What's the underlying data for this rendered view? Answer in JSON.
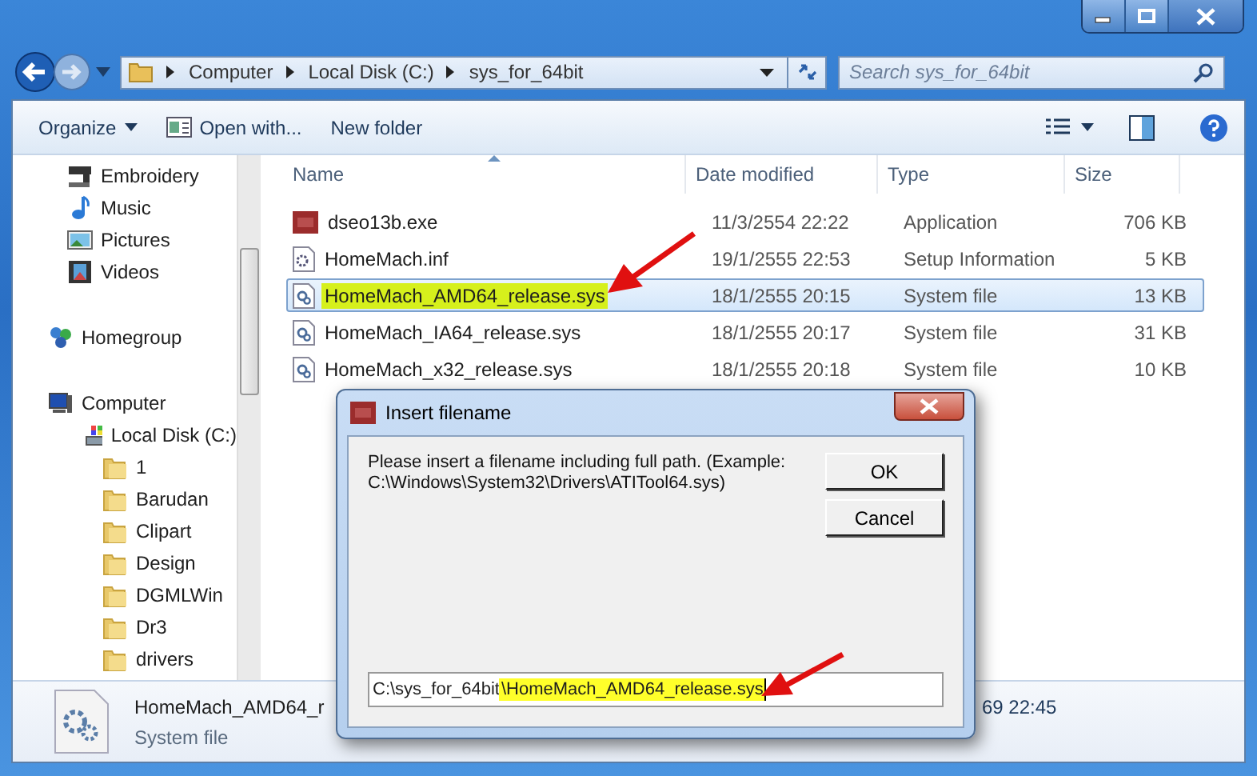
{
  "navigation": {
    "breadcrumb": [
      "Computer",
      "Local Disk (C:)",
      "sys_for_64bit"
    ]
  },
  "search": {
    "placeholder": "Search sys_for_64bit"
  },
  "toolbar": {
    "buttons": [
      {
        "label": "Organize",
        "kind": "menu"
      },
      {
        "label": "Open with...",
        "kind": "icon"
      },
      {
        "label": "New folder",
        "kind": "plain"
      }
    ]
  },
  "sidebar": {
    "items": [
      {
        "label": "Embroidery",
        "kind": "machine"
      },
      {
        "label": "Music",
        "kind": "music"
      },
      {
        "label": "Pictures",
        "kind": "pictures"
      },
      {
        "label": "Videos",
        "kind": "videos"
      },
      {
        "label": "Homegroup",
        "kind": "homegroup"
      },
      {
        "label": "Computer",
        "kind": "computer",
        "children": [
          {
            "label": "Local Disk (C:)",
            "kind": "drive",
            "children": [
              {
                "label": "1",
                "kind": "folder"
              },
              {
                "label": "Barudan",
                "kind": "folder"
              },
              {
                "label": "Clipart",
                "kind": "folder"
              },
              {
                "label": "Design",
                "kind": "folder"
              },
              {
                "label": "DGMLWin",
                "kind": "folder"
              },
              {
                "label": "Dr3",
                "kind": "folder"
              },
              {
                "label": "drivers",
                "kind": "folder"
              }
            ]
          }
        ]
      }
    ]
  },
  "table": {
    "columns": [
      {
        "label": "Name",
        "sorted": true
      },
      {
        "label": "Date modified",
        "sorted": false
      },
      {
        "label": "Type",
        "sorted": false
      },
      {
        "label": "Size",
        "sorted": false
      }
    ],
    "rows": [
      {
        "name": "dseo13b.exe",
        "date": "11/3/2554 22:22",
        "type": "Application",
        "size": "706 KB",
        "kind": "exe",
        "selected": false,
        "highlighted": false
      },
      {
        "name": "HomeMach.inf",
        "date": "19/1/2555 22:53",
        "type": "Setup Information",
        "size": "5 KB",
        "kind": "inf",
        "selected": false,
        "highlighted": false
      },
      {
        "name": "HomeMach_AMD64_release.sys",
        "date": "18/1/2555 20:15",
        "type": "System file",
        "size": "13 KB",
        "kind": "sys",
        "selected": true,
        "highlighted": true
      },
      {
        "name": "HomeMach_IA64_release.sys",
        "date": "18/1/2555 20:17",
        "type": "System file",
        "size": "31 KB",
        "kind": "sys",
        "selected": false,
        "highlighted": false
      },
      {
        "name": "HomeMach_x32_release.sys",
        "date": "18/1/2555 20:18",
        "type": "System file",
        "size": "10 KB",
        "kind": "sys",
        "selected": false,
        "highlighted": false
      }
    ]
  },
  "details": {
    "name": "HomeMach_AMD64_r",
    "type": "System file",
    "date": "69 22:45"
  },
  "dialog": {
    "title": "Insert filename",
    "message": "Please insert a filename including full path. (Example:\nC:\\Windows\\System32\\Drivers\\ATITool64.sys)",
    "buttons": [
      "OK",
      "Cancel"
    ],
    "input": {
      "value": "C:\\sys_for_64bit",
      "selected_text": "\\HomeMach_AMD64_release.sys"
    }
  }
}
